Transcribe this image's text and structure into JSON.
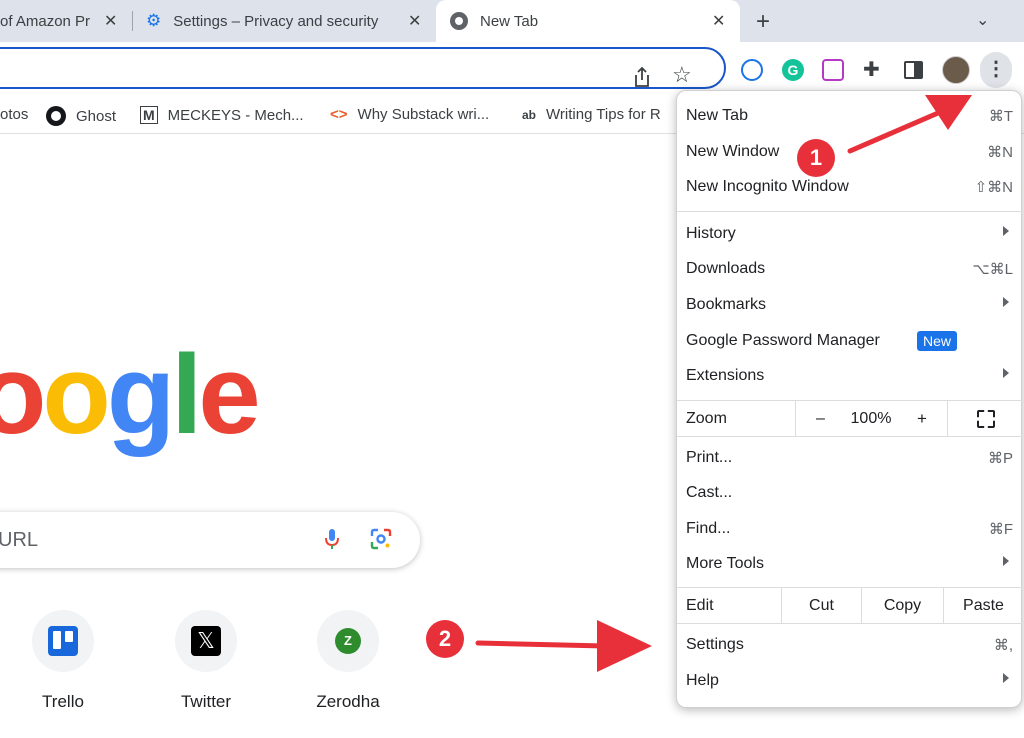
{
  "tabs": [
    {
      "label": "of Amazon Pr"
    },
    {
      "label": "Settings – Privacy and security"
    },
    {
      "label": "New Tab"
    }
  ],
  "bookmarks": {
    "items": [
      {
        "label": "otos"
      },
      {
        "label": "Ghost"
      },
      {
        "label": "MECKEYS - Mech..."
      },
      {
        "label": "Why Substack wri..."
      },
      {
        "label": "Writing Tips for R"
      }
    ]
  },
  "search": {
    "placeholder": "URL"
  },
  "shortcuts": [
    {
      "label": "Trello",
      "icon": "trello-icon"
    },
    {
      "label": "Twitter",
      "icon": "x-icon"
    },
    {
      "label": "Zerodha",
      "icon": "zerodha-icon",
      "letter": "Z"
    }
  ],
  "logo": {
    "letters": [
      "o",
      "o",
      "g",
      "l",
      "e"
    ]
  },
  "menu": {
    "new_tab": {
      "label": "New Tab",
      "shortcut": "⌘T"
    },
    "new_window": {
      "label": "New Window",
      "shortcut": "⌘N"
    },
    "new_incognito": {
      "label": "New Incognito Window",
      "shortcut": "⇧⌘N"
    },
    "history": {
      "label": "History"
    },
    "downloads": {
      "label": "Downloads",
      "shortcut": "⌥⌘L"
    },
    "bookmarks": {
      "label": "Bookmarks"
    },
    "password_manager": {
      "label": "Google Password Manager",
      "badge": "New"
    },
    "extensions": {
      "label": "Extensions"
    },
    "zoom": {
      "label": "Zoom",
      "minus": "–",
      "value": "100%",
      "plus": "+"
    },
    "print": {
      "label": "Print...",
      "shortcut": "⌘P"
    },
    "cast": {
      "label": "Cast..."
    },
    "find": {
      "label": "Find...",
      "shortcut": "⌘F"
    },
    "more_tools": {
      "label": "More Tools"
    },
    "edit": {
      "label": "Edit",
      "cut": "Cut",
      "copy": "Copy",
      "paste": "Paste"
    },
    "settings": {
      "label": "Settings",
      "shortcut": "⌘,"
    },
    "help": {
      "label": "Help"
    }
  },
  "annotations": {
    "step1": "1",
    "step2": "2"
  },
  "colors": {
    "accent": "#1a73e8",
    "annotation": "#e8303a",
    "google_blue": "#4285f4",
    "google_red": "#ea4335",
    "google_yellow": "#fbbc05",
    "google_green": "#34a853"
  }
}
